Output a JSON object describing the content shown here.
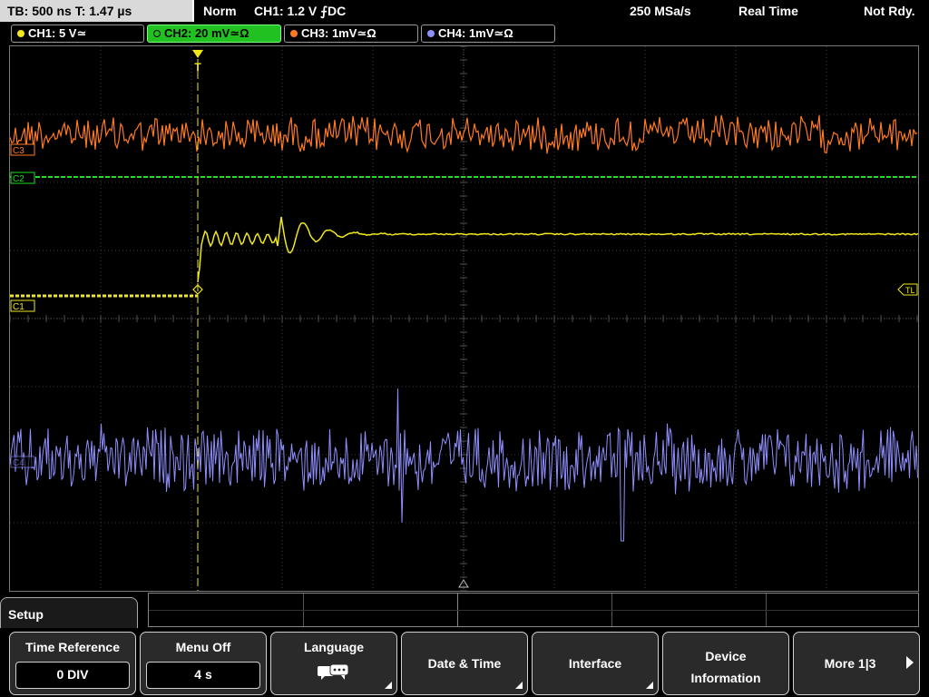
{
  "status_bar": {
    "timebase": "TB: 500 ns   T: 1.47 µs",
    "acq_mode": "Norm",
    "trigger": "CH1: 1.2 V ⨍DC",
    "sample_rate": "250 MSa/s",
    "real_time": "Real Time",
    "trigger_status": "Not Rdy."
  },
  "channels": [
    {
      "label": "CH1: 5 V≃",
      "color": "#f0e81a",
      "active": false
    },
    {
      "label": "CH2: 20 mV≃Ω",
      "color": "#2ee52e",
      "active": true
    },
    {
      "label": "CH3: 1mV≃Ω",
      "color": "#ff7a24",
      "active": false
    },
    {
      "label": "CH4: 1mV≃Ω",
      "color": "#8f8fff",
      "active": false
    }
  ],
  "waveform_markers": {
    "c3": "C3",
    "c2": "C2",
    "c1": "C1",
    "c4": "C4",
    "trigger_level": "TL",
    "trigger_position": "T"
  },
  "menu": {
    "title": "Setup",
    "softkeys": [
      {
        "label": "Time Reference",
        "value": "0 DIV"
      },
      {
        "label": "Menu Off",
        "value": "4 s"
      },
      {
        "label": "Language",
        "icon": "speech-bubbles-icon"
      },
      {
        "label": "Date & Time"
      },
      {
        "label": "Interface"
      },
      {
        "label_line1": "Device",
        "label_line2": "Information"
      },
      {
        "label": "More 1|3"
      }
    ]
  }
}
